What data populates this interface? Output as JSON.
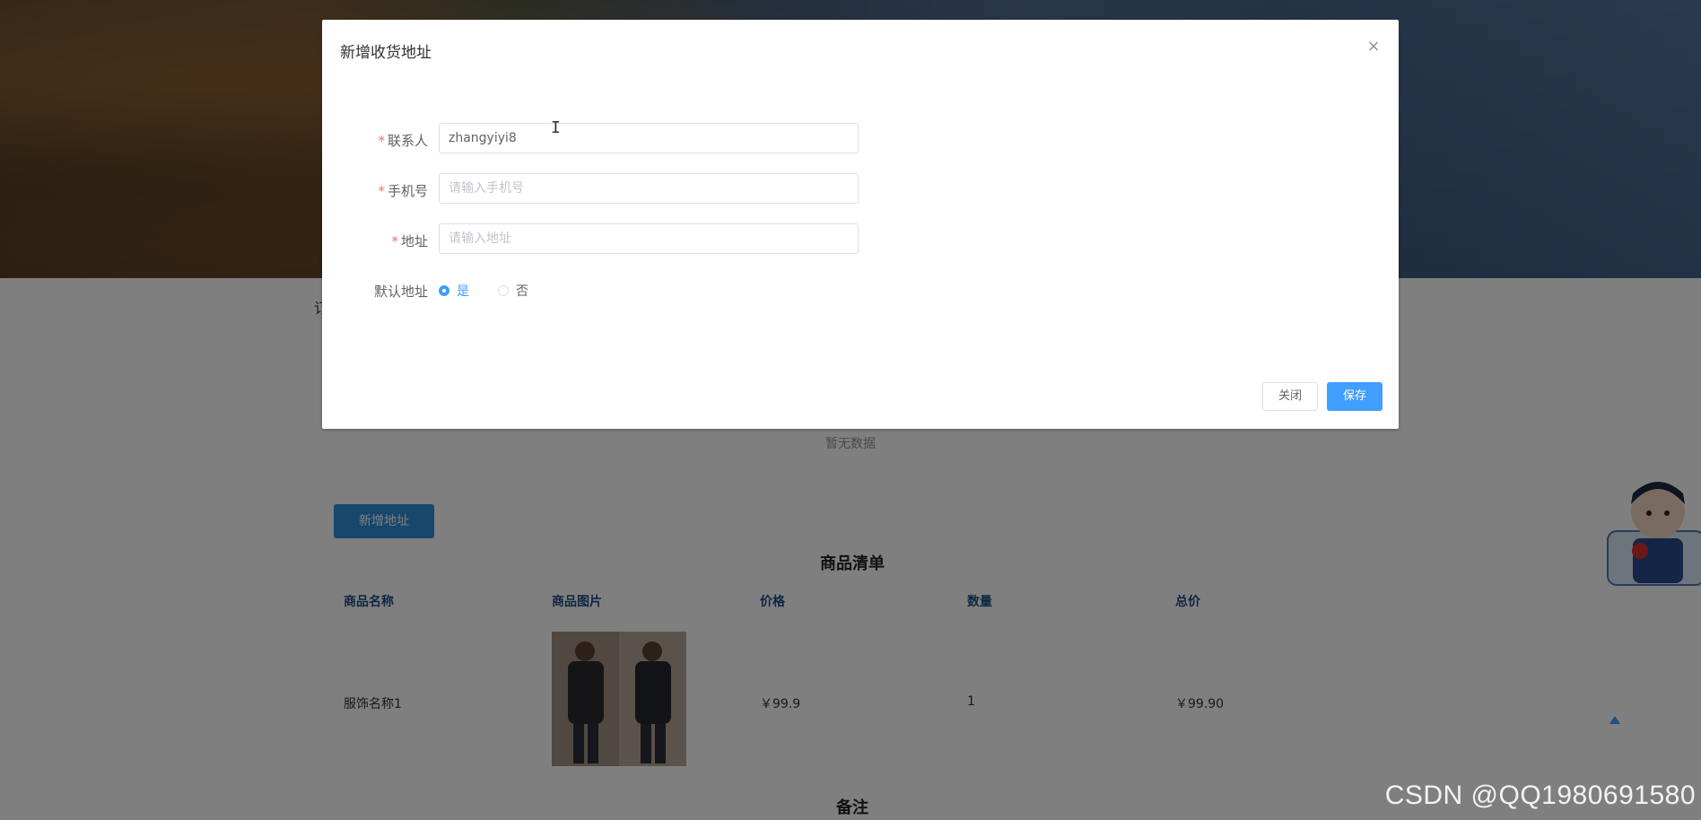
{
  "dialog": {
    "title": "新增收货地址",
    "close_icon": "close-icon",
    "fields": {
      "contact": {
        "label": "联系人",
        "value": "zhangyiyi8",
        "placeholder": ""
      },
      "phone": {
        "label": "手机号",
        "value": "",
        "placeholder": "请输入手机号"
      },
      "address": {
        "label": "地址",
        "value": "",
        "placeholder": "请输入地址"
      },
      "default": {
        "label": "默认地址",
        "options": [
          "是",
          "否"
        ],
        "selected": "是"
      }
    },
    "buttons": {
      "close": "关闭",
      "save": "保存"
    },
    "required_mark": "*"
  },
  "page": {
    "empty_text": "暂无数据",
    "add_address_button": "新增地址",
    "goods_title": "商品清单",
    "table": {
      "headers": [
        "商品名称",
        "商品图片",
        "价格",
        "数量",
        "总价"
      ],
      "rows": [
        {
          "name": "服饰名称1",
          "price": "￥99.9",
          "quantity": "1",
          "total": "￥99.90"
        }
      ]
    },
    "remark_title": "备注",
    "cut_text": "订"
  },
  "watermark": "CSDN @QQ1980691580",
  "colors": {
    "primary": "#409eff",
    "required": "#f56c6c",
    "header_text": "#1f4f84"
  }
}
